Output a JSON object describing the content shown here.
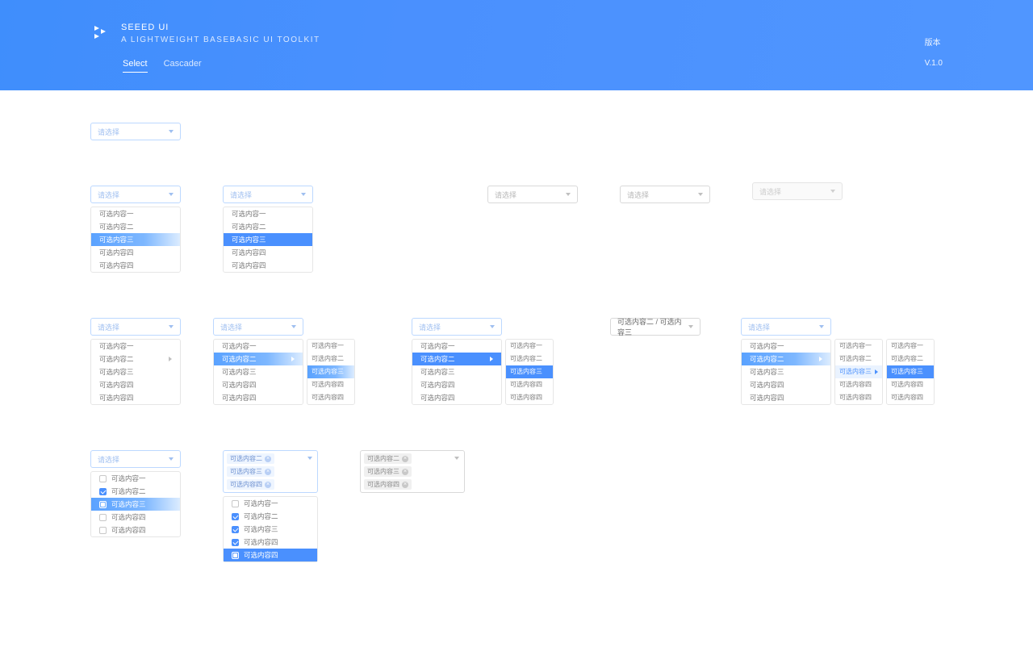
{
  "header": {
    "title": "SEEED UI",
    "subtitle": "A LIGHTWEIGHT BASEBASIC UI TOOLKIT",
    "nav": {
      "select": "Select",
      "cascader": "Cascader"
    },
    "version_label": "版本",
    "version_value": "V.1.0"
  },
  "placeholder": "请选择",
  "options": {
    "o1": "可选内容一",
    "o2": "可选内容二",
    "o3": "可选内容三",
    "o4": "可选内容四",
    "o4b": "可选内容四"
  },
  "breadcrumb_value": "可选内容二 / 可选内容三"
}
